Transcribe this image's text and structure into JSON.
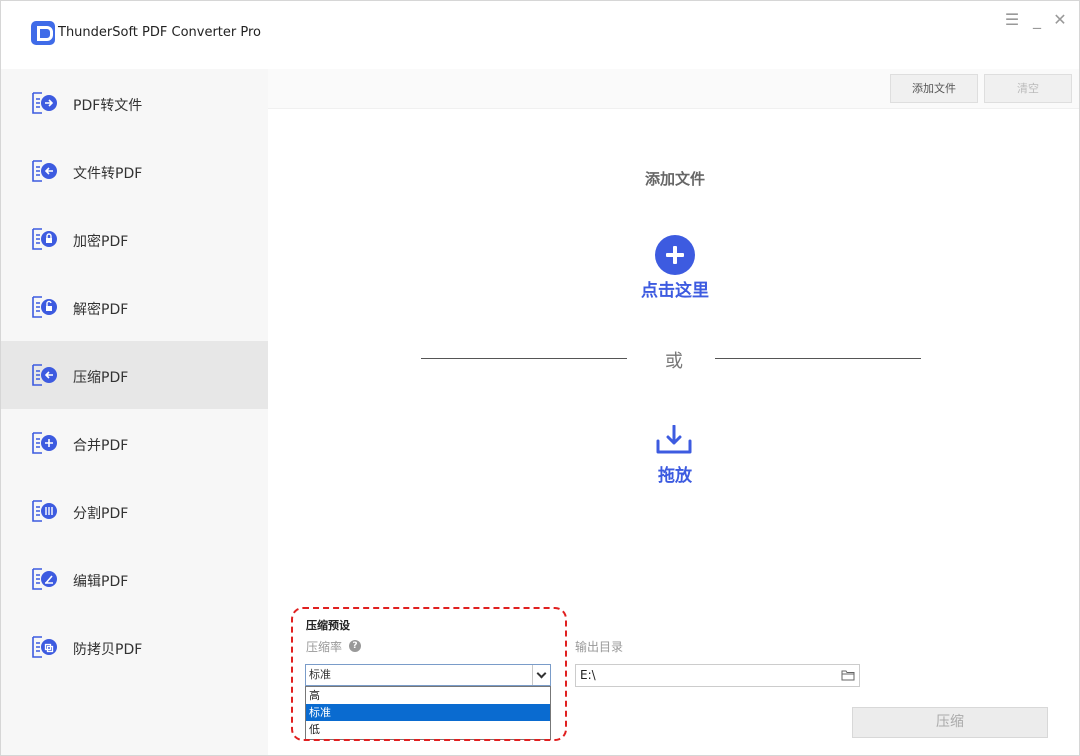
{
  "app": {
    "title": "ThunderSoft PDF Converter Pro",
    "accent_color": "#3d5be0"
  },
  "window_controls": {
    "menu": "☰",
    "minimize": "_",
    "close": "✕"
  },
  "sidebar": {
    "items": [
      {
        "label": "PDF转文件",
        "icon": "file-export-icon"
      },
      {
        "label": "文件转PDF",
        "icon": "file-import-icon"
      },
      {
        "label": "加密PDF",
        "icon": "lock-icon"
      },
      {
        "label": "解密PDF",
        "icon": "unlock-icon"
      },
      {
        "label": "压缩PDF",
        "icon": "compress-icon",
        "active": true
      },
      {
        "label": "合并PDF",
        "icon": "merge-icon"
      },
      {
        "label": "分割PDF",
        "icon": "split-icon"
      },
      {
        "label": "编辑PDF",
        "icon": "edit-icon"
      },
      {
        "label": "防拷贝PDF",
        "icon": "copy-protect-icon"
      }
    ]
  },
  "toolbar": {
    "add_files": "添加文件",
    "clear": "清空"
  },
  "drop_area": {
    "heading": "添加文件",
    "click_here": "点击这里",
    "or": "或",
    "drag_drop": "拖放"
  },
  "settings": {
    "preset_title": "压缩预设",
    "rate_label": "压缩率",
    "help": "?",
    "rate_value": "标准",
    "rate_options": [
      "高",
      "标准",
      "低"
    ],
    "selected_option": "标准",
    "output_label": "输出目录",
    "output_value": "E:\\"
  },
  "actions": {
    "compress": "压缩"
  }
}
